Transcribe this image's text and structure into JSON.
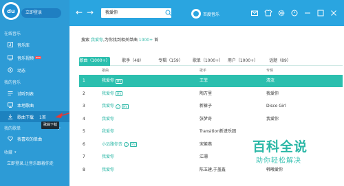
{
  "sidebar": {
    "logo_text": "du",
    "login": "立即登录",
    "online_music_label": "在线音乐",
    "items_online": [
      {
        "label": "音乐库",
        "icon": "music-note-icon"
      },
      {
        "label": "音乐视频",
        "icon": "video-icon",
        "badge": "NEW"
      },
      {
        "label": "动态",
        "icon": "circle-icon"
      }
    ],
    "my_music_label": "我的音乐",
    "items_my": [
      {
        "label": "试听列表",
        "icon": "list-icon"
      },
      {
        "label": "本地歌曲",
        "icon": "monitor-icon"
      },
      {
        "label": "歌曲下载",
        "icon": "download-icon",
        "count": "1首"
      }
    ],
    "tooltip": "歌曲下载",
    "playlist_label": "我的歌单",
    "favorites": "我喜欢的单曲",
    "favorites_label": "收藏",
    "login_prompt": "立即登录,让音乐跟着你走"
  },
  "topbar": {
    "search_value": "我爱你",
    "brand": "百度音乐"
  },
  "main": {
    "result_prefix": "搜索",
    "result_query": "我爱你",
    "result_mid": ",为你找到相关单曲",
    "result_count": "1000+",
    "result_suffix": "首",
    "tabs": [
      {
        "label": "歌曲（1000+）"
      },
      {
        "label": "歌手（48）"
      },
      {
        "label": "专辑（159）"
      },
      {
        "label": "歌单（1000+）"
      },
      {
        "label": "用户（1000+）"
      },
      {
        "label": "话题（89）"
      }
    ],
    "columns": {
      "song": "歌曲",
      "singer": "歌手",
      "album": "专辑"
    },
    "rows": [
      {
        "num": "1",
        "song": "我爱你",
        "mv": "MV",
        "sq": "",
        "singer": "王菲",
        "album": "清流"
      },
      {
        "num": "2",
        "song": "我爱你",
        "mv": "MV",
        "sq": "",
        "singer": "陶万里",
        "album": "我爱你"
      },
      {
        "num": "3",
        "song": "我爱你",
        "mv": "MV",
        "sq": "♪",
        "singer": "新裤子",
        "album": "Disco Girl"
      },
      {
        "num": "4",
        "song": "我爱你",
        "mv": "",
        "sq": "",
        "singer": "张梦奇",
        "album": "我爱你"
      },
      {
        "num": "5",
        "song": "我爱你",
        "mv": "",
        "sq": "",
        "singer": "Transition新进乐团",
        "album": ""
      },
      {
        "num": "6",
        "song": "小远路你去",
        "mv": "MV",
        "sq": "♪",
        "singer": "宋紫燕",
        "album": ""
      },
      {
        "num": "7",
        "song": "我爱你",
        "mv": "",
        "sq": "",
        "singer": "江珊",
        "album": ""
      },
      {
        "num": "8",
        "song": "我爱你",
        "mv": "",
        "sq": "",
        "singer": "陈玉建,于盖鑫",
        "album": "韩曦爱你"
      }
    ]
  },
  "watermark": {
    "title": "百科全说",
    "subtitle": "助你轻松解决"
  },
  "colors": {
    "sidebar": "#2d9bd6",
    "topbar": "#2aa5e0",
    "accent": "#2bbfae"
  }
}
